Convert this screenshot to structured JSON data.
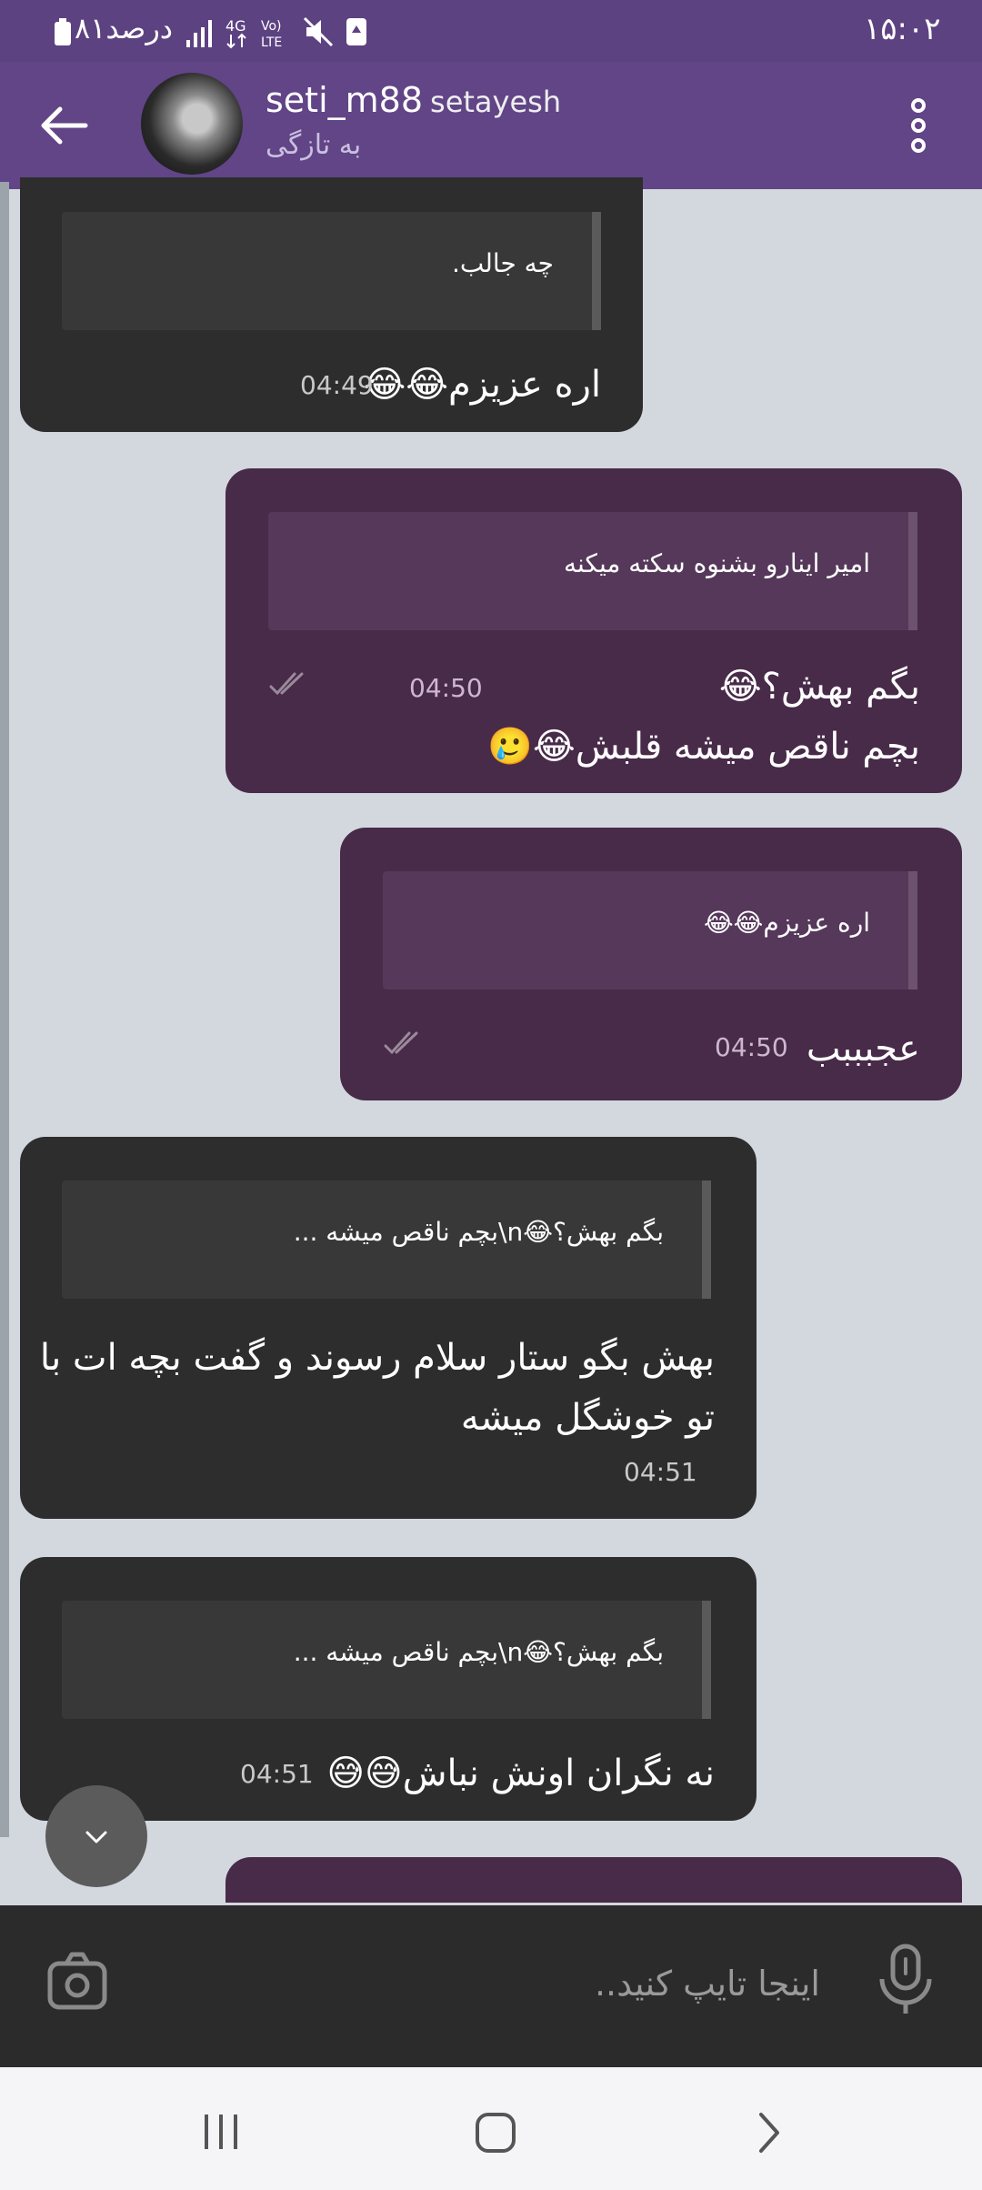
{
  "status_bar": {
    "time": "۱۵:۰۲",
    "battery_text": "۸۱درصد",
    "network_label": "4G",
    "volte_label": "Vo) LTE"
  },
  "header": {
    "username": "seti_m88",
    "display_name": "setayesh",
    "status": "به تازگی"
  },
  "messages": [
    {
      "reply_text": "چه جالب.",
      "text": "اره عزیزم😂😂",
      "time": "04:49",
      "direction": "incoming"
    },
    {
      "reply_text": "امیر اینارو بشنوه سکته میکنه",
      "text_line1": "بگم بهش؟😂",
      "text_line2": "بچم ناقص میشه قلبش😂🥲",
      "time": "04:50",
      "direction": "outgoing"
    },
    {
      "reply_text": "اره عزیزم😂😂",
      "text": "عجبببب",
      "time": "04:50",
      "direction": "outgoing"
    },
    {
      "reply_text": "بگم بهش؟😂n\\بچم ناقص میشه ...",
      "text_line1": "بهش بگو ستار سلام رسوند و گفت بچه ات با",
      "text_line2": "تو خوشگل میشه",
      "time": "04:51",
      "direction": "incoming"
    },
    {
      "reply_text": "بگم بهش؟😂n\\بچم ناقص میشه ...",
      "text": "نه نگران اونش نباش😅😅",
      "time": "04:51",
      "direction": "incoming"
    }
  ],
  "composer": {
    "placeholder": "اینجا تایپ کنید.."
  },
  "icons": {
    "back": "arrow-left-icon",
    "menu": "more-vertical-icon",
    "scroll_down": "chevron-down-icon",
    "camera": "camera-icon",
    "mic": "microphone-icon",
    "nav_recents": "recents-icon",
    "nav_home": "home-icon",
    "nav_back": "chevron-right-icon"
  },
  "colors": {
    "header": "#614587",
    "incoming_bubble": "#2d2d2d",
    "outgoing_bubble": "#482a49",
    "chat_background": "#d3d8de"
  }
}
